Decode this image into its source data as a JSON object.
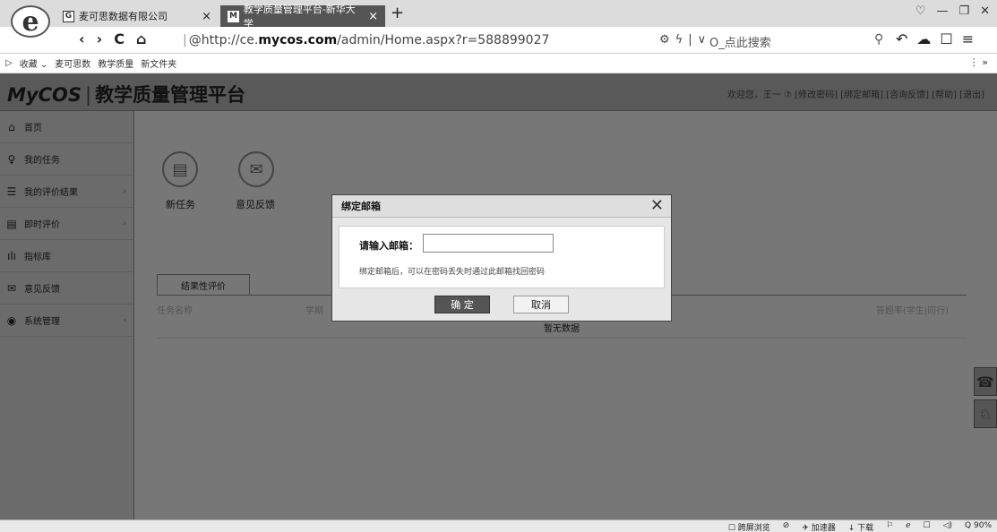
{
  "browser": {
    "tabs": [
      {
        "label": "麦可思数据有限公司",
        "icon": "G",
        "close": "×"
      },
      {
        "label": "教学质量管理平台-新华大学",
        "icon": "M",
        "close": "×"
      }
    ],
    "new_tab": "+",
    "window_controls": [
      "♡",
      "—",
      "❐",
      "✕"
    ],
    "nav": [
      "‹",
      "›",
      "C",
      "⌂"
    ],
    "url_prefix": "http://ce.",
    "url_domain": "mycos.com",
    "url_path": "/admin/Home.aspx?r=588899027",
    "addr_tools": [
      "⚙",
      "ϟ",
      "|",
      "∨"
    ],
    "search_placeholder": "O_点此搜索",
    "bookmarks": [
      "▷",
      "收藏 ⌄",
      "麦可思数",
      "教学质量",
      "新文件夹"
    ],
    "bookmark_more": "⋮  »"
  },
  "header": {
    "brand": "MyCOS",
    "divider": "|",
    "title": "教学质量管理平台",
    "welcome": "欢迎您，王一 ⑦  [修改密码]  [绑定邮箱]  [咨询反馈]  [帮助]  [退出]"
  },
  "sidebar": {
    "items": [
      {
        "label": "首页",
        "icon": "⌂",
        "arrow": ""
      },
      {
        "label": "我的任务",
        "icon": "♀",
        "arrow": ""
      },
      {
        "label": "我的评价结果",
        "icon": "☰",
        "arrow": "›"
      },
      {
        "label": "即时评价",
        "icon": "▤",
        "arrow": "›"
      },
      {
        "label": "指标库",
        "icon": "ılı",
        "arrow": ""
      },
      {
        "label": "意见反馈",
        "icon": "✉",
        "arrow": ""
      },
      {
        "label": "系统管理",
        "icon": "◉",
        "arrow": "›"
      }
    ]
  },
  "main": {
    "quick": [
      {
        "label": "新任务",
        "icon": "▤"
      },
      {
        "label": "意见反馈",
        "icon": "✉"
      }
    ],
    "result_tab": "结果性评价",
    "columns": [
      "任务名称",
      "学期",
      "答题率(学生|同行)"
    ],
    "empty": "暂无数据"
  },
  "float_buttons": [
    "☎",
    "♘"
  ],
  "modal": {
    "title": "绑定邮箱",
    "close": "✕",
    "label": "请输入邮箱：",
    "email_value": "",
    "hint": "绑定邮箱后，可以在密码丢失时通过此邮箱找回密码",
    "ok": "确 定",
    "cancel": "取消"
  },
  "statusbar": [
    "☐ 跨屏浏览",
    "⊘",
    "✈ 加速器",
    "↓ 下载",
    "⚐",
    "ℯ",
    "☐",
    "◁)",
    "Q 90%"
  ]
}
